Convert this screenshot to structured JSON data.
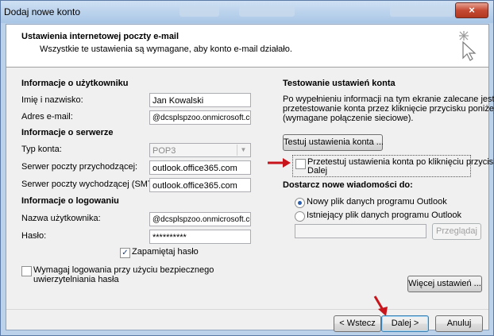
{
  "window": {
    "title": "Dodaj nowe konto",
    "close_glyph": "×"
  },
  "header": {
    "title": "Ustawienia internetowej poczty e-mail",
    "subtitle": "Wszystkie te ustawienia są wymagane, aby konto e-mail działało."
  },
  "user_info": {
    "heading": "Informacje o użytkowniku",
    "name_label": "Imię i nazwisko:",
    "name_value": "Jan Kowalski",
    "email_label": "Adres e-mail:",
    "email_value": "@dcsplspzoo.onmicrosoft.com"
  },
  "server_info": {
    "heading": "Informacje o serwerze",
    "account_type_label": "Typ konta:",
    "account_type_value": "POP3",
    "incoming_label": "Serwer poczty przychodzącej:",
    "incoming_value": "outlook.office365.com",
    "outgoing_label": "Serwer poczty wychodzącej (SMTP):",
    "outgoing_value": "outlook.office365.com"
  },
  "logon_info": {
    "heading": "Informacje o logowaniu",
    "username_label": "Nazwa użytkownika:",
    "username_value": "@dcsplspzoo.onmicrosoft.com",
    "password_label": "Hasło:",
    "password_value": "**********",
    "remember_label": "Zapamiętaj hasło",
    "remember_checked": true,
    "spa_label_line1": "Wymagaj logowania przy użyciu bezpiecznego",
    "spa_label_line2": "uwierzytelniania hasła",
    "spa_checked": false
  },
  "test": {
    "heading": "Testowanie ustawień konta",
    "desc_line1": "Po wypełnieniu informacji na tym ekranie zalecane jest",
    "desc_line2": "przetestowanie konta przez kliknięcie przycisku poniżej",
    "desc_line3": "(wymagane połączenie sieciowe).",
    "test_button": "Testuj ustawienia konta ...",
    "auto_test_line1": "Przetestuj ustawienia konta po kliknięciu przycisku",
    "auto_test_line2": "Dalej",
    "auto_test_checked": false
  },
  "deliver": {
    "heading": "Dostarcz nowe wiadomości do:",
    "option_new": "Nowy plik danych programu Outlook",
    "option_existing": "Istniejący plik danych programu Outlook",
    "selected": "new",
    "path_value": "",
    "browse_button": "Przeglądaj"
  },
  "more_settings_button": "Więcej ustawień ...",
  "footer": {
    "back": "< Wstecz",
    "next": "Dalej >",
    "cancel": "Anuluj"
  },
  "colors": {
    "annotation_arrow": "#c8151b",
    "window_frame": "#bcd2ea"
  }
}
